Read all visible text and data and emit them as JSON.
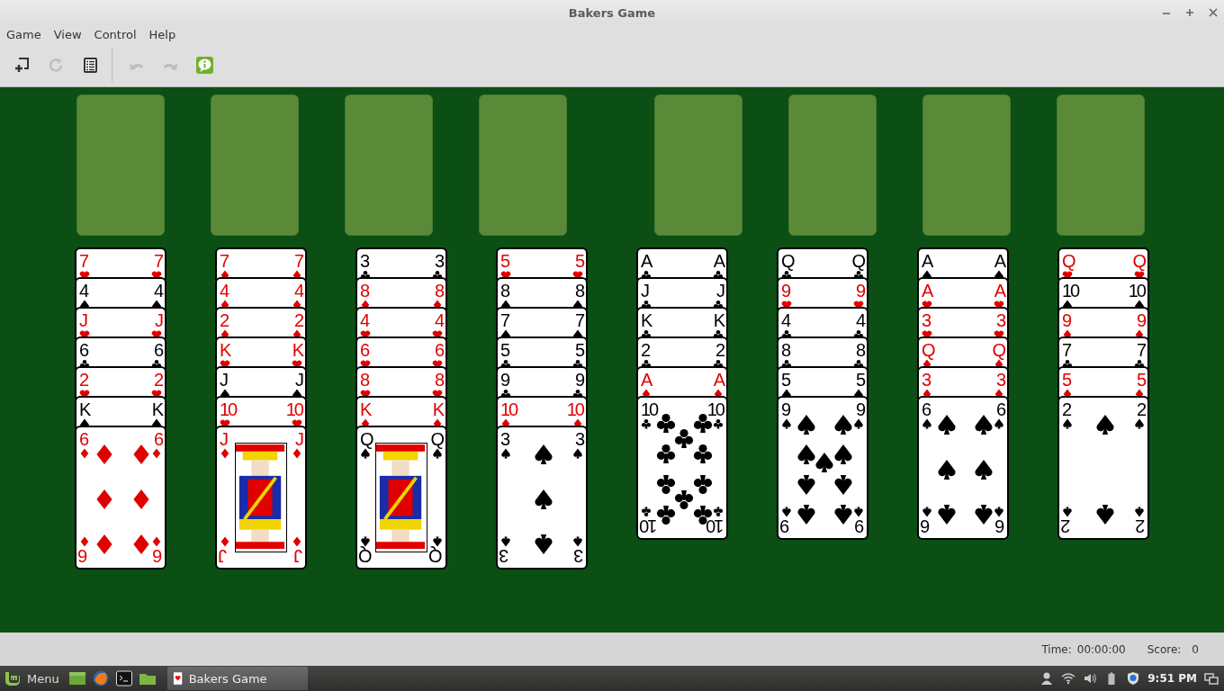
{
  "window": {
    "title": "Bakers Game"
  },
  "menu": [
    "Game",
    "View",
    "Control",
    "Help"
  ],
  "toolbar": [
    {
      "kind": "new",
      "disabled": false
    },
    {
      "kind": "restart",
      "disabled": true
    },
    {
      "kind": "statistics",
      "disabled": false
    },
    {
      "kind": "undo",
      "disabled": true
    },
    {
      "kind": "redo",
      "disabled": true
    },
    {
      "kind": "hint",
      "disabled": false
    }
  ],
  "tableau": [
    {
      "cards": [
        {
          "kind": "hearts",
          "indices": [
            "7",
            "7"
          ]
        },
        {
          "kind": "spades",
          "indices": [
            "4",
            "4"
          ]
        },
        {
          "kind": "hearts",
          "indices": [
            "J",
            "J"
          ]
        },
        {
          "kind": "clubs",
          "indices": [
            "6",
            "6"
          ]
        },
        {
          "kind": "hearts",
          "indices": [
            "2",
            "2"
          ]
        },
        {
          "kind": "spades",
          "indices": [
            "K",
            "K"
          ]
        },
        {
          "kind": "diamonds",
          "indices": [
            "6",
            "6",
            "6",
            "6"
          ],
          "center": {
            "kind": "six"
          }
        }
      ]
    },
    {
      "cards": [
        {
          "kind": "diamonds",
          "indices": [
            "7",
            "7"
          ]
        },
        {
          "kind": "diamonds",
          "indices": [
            "4",
            "4"
          ]
        },
        {
          "kind": "diamonds",
          "indices": [
            "2",
            "2"
          ]
        },
        {
          "kind": "hearts",
          "indices": [
            "K",
            "K"
          ]
        },
        {
          "kind": "spades",
          "indices": [
            "J",
            "J"
          ]
        },
        {
          "kind": "hearts",
          "indices": [
            "10",
            "10"
          ]
        },
        {
          "kind": "diamonds",
          "indices": [
            "J",
            "J",
            "J",
            "J"
          ],
          "center": {
            "kind": "portrait"
          }
        }
      ]
    },
    {
      "cards": [
        {
          "kind": "clubs",
          "indices": [
            "3",
            "3"
          ]
        },
        {
          "kind": "diamonds",
          "indices": [
            "8",
            "8"
          ]
        },
        {
          "kind": "hearts",
          "indices": [
            "4",
            "4"
          ]
        },
        {
          "kind": "hearts",
          "indices": [
            "6",
            "6"
          ]
        },
        {
          "kind": "hearts",
          "indices": [
            "8",
            "8"
          ]
        },
        {
          "kind": "diamonds",
          "indices": [
            "K",
            "K"
          ]
        },
        {
          "kind": "spades",
          "indices": [
            "Q",
            "Q",
            "Q",
            "Q"
          ],
          "center": {
            "kind": "portrait"
          }
        }
      ]
    },
    {
      "cards": [
        {
          "kind": "hearts",
          "indices": [
            "5",
            "5"
          ]
        },
        {
          "kind": "spades",
          "indices": [
            "8",
            "8"
          ]
        },
        {
          "kind": "spades",
          "indices": [
            "7",
            "7"
          ]
        },
        {
          "kind": "clubs",
          "indices": [
            "5",
            "5"
          ]
        },
        {
          "kind": "clubs",
          "indices": [
            "9",
            "9"
          ]
        },
        {
          "kind": "diamonds",
          "indices": [
            "10",
            "10"
          ]
        },
        {
          "kind": "spades",
          "indices": [
            "3",
            "3",
            "3",
            "3"
          ],
          "center": {
            "kind": "three"
          }
        }
      ]
    },
    {
      "cards": [
        {
          "kind": "clubs",
          "indices": [
            "A",
            "A"
          ]
        },
        {
          "kind": "clubs",
          "indices": [
            "J",
            "J"
          ]
        },
        {
          "kind": "clubs",
          "indices": [
            "K",
            "K"
          ]
        },
        {
          "kind": "clubs",
          "indices": [
            "2",
            "2"
          ]
        },
        {
          "kind": "diamonds",
          "indices": [
            "A",
            "A"
          ]
        },
        {
          "kind": "clubs",
          "indices": [
            "10",
            "10",
            "10",
            "10"
          ],
          "center": {
            "kind": "ten"
          }
        }
      ]
    },
    {
      "cards": [
        {
          "kind": "clubs",
          "indices": [
            "Q",
            "Q"
          ]
        },
        {
          "kind": "hearts",
          "indices": [
            "9",
            "9"
          ]
        },
        {
          "kind": "clubs",
          "indices": [
            "4",
            "4"
          ]
        },
        {
          "kind": "clubs",
          "indices": [
            "8",
            "8"
          ]
        },
        {
          "kind": "spades",
          "indices": [
            "5",
            "5"
          ]
        },
        {
          "kind": "spades",
          "indices": [
            "9",
            "9",
            "9",
            "9"
          ],
          "center": {
            "kind": "nine"
          }
        }
      ]
    },
    {
      "cards": [
        {
          "kind": "spades",
          "indices": [
            "A",
            "A"
          ]
        },
        {
          "kind": "hearts",
          "indices": [
            "A",
            "A"
          ]
        },
        {
          "kind": "hearts",
          "indices": [
            "3",
            "3"
          ]
        },
        {
          "kind": "diamonds",
          "indices": [
            "Q",
            "Q"
          ]
        },
        {
          "kind": "diamonds",
          "indices": [
            "3",
            "3"
          ]
        },
        {
          "kind": "spades",
          "indices": [
            "6",
            "6",
            "6",
            "6"
          ],
          "center": {
            "kind": "six"
          }
        }
      ]
    },
    {
      "cards": [
        {
          "kind": "hearts",
          "indices": [
            "Q",
            "Q"
          ]
        },
        {
          "kind": "spades",
          "indices": [
            "10",
            "10"
          ]
        },
        {
          "kind": "diamonds",
          "indices": [
            "9",
            "9"
          ]
        },
        {
          "kind": "clubs",
          "indices": [
            "7",
            "7"
          ]
        },
        {
          "kind": "diamonds",
          "indices": [
            "5",
            "5"
          ]
        },
        {
          "kind": "spades",
          "indices": [
            "2",
            "2",
            "2",
            "2"
          ],
          "center": {
            "kind": "two"
          }
        }
      ]
    }
  ],
  "status_bar": {
    "time_label": "Time:",
    "time": "00:00:00",
    "score_label": "Score:",
    "score": "0"
  },
  "taskbar": {
    "menu_label": "Menu",
    "launchers": [
      {
        "kind": "desktop"
      },
      {
        "kind": "browser"
      },
      {
        "kind": "terminal"
      },
      {
        "kind": "folder"
      }
    ],
    "windows": [
      {
        "title": "Bakers Game"
      }
    ],
    "clock": "9:51 PM"
  }
}
